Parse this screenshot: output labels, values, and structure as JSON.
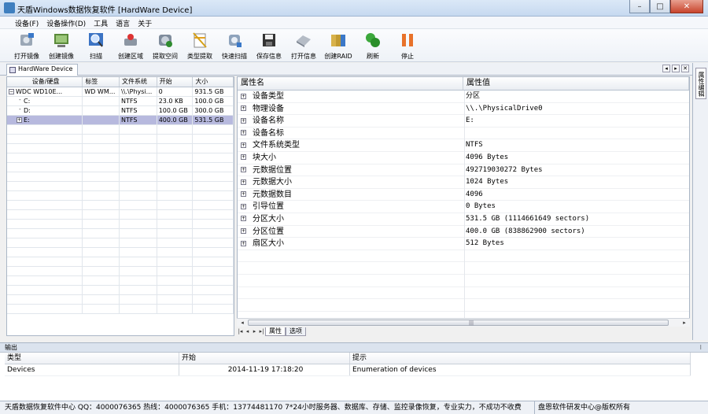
{
  "window": {
    "title": "天盾Windows数据恢复软件  [HardWare Device]",
    "buttons": [
      "–",
      "□",
      "✕"
    ]
  },
  "menu": [
    "设备(F)",
    "设备操作(D)",
    "工具",
    "语言",
    "关于"
  ],
  "toolbar": [
    {
      "label": "打开镜像",
      "icon": "open-image-icon"
    },
    {
      "label": "创建镜像",
      "icon": "create-image-icon"
    },
    {
      "label": "扫描",
      "icon": "scan-icon"
    },
    {
      "label": "创建区域",
      "icon": "create-region-icon"
    },
    {
      "label": "提取空间",
      "icon": "extract-space-icon"
    },
    {
      "label": "类型提取",
      "icon": "type-extract-icon"
    },
    {
      "label": "快速扫描",
      "icon": "quick-scan-icon"
    },
    {
      "label": "保存信息",
      "icon": "save-info-icon"
    },
    {
      "label": "打开信息",
      "icon": "open-info-icon"
    },
    {
      "label": "创建RAID",
      "icon": "create-raid-icon"
    },
    {
      "label": "刷新",
      "icon": "refresh-icon"
    },
    {
      "label": "停止",
      "icon": "stop-icon"
    }
  ],
  "doc_tab": "HardWare Device",
  "side_tab": "属性编辑",
  "device_table": {
    "headers": [
      "设备/硬盘",
      "标签",
      "文件系统",
      "开始",
      "大小"
    ],
    "rows": [
      {
        "expand": "−",
        "indent": 0,
        "name": "WDC WD10E...",
        "label": "WD WM...",
        "fs": "\\\\.\\Physi...",
        "start": "0",
        "size": "931.5 GB",
        "selected": false
      },
      {
        "expand": "",
        "indent": 1,
        "name": "C:",
        "label": "",
        "fs": "NTFS",
        "start": "23.0 KB",
        "size": "100.0 GB",
        "selected": false
      },
      {
        "expand": "",
        "indent": 1,
        "name": "D:",
        "label": "",
        "fs": "NTFS",
        "start": "100.0 GB",
        "size": "300.0 GB",
        "selected": false
      },
      {
        "expand": "+",
        "indent": 1,
        "name": "E:",
        "label": "",
        "fs": "NTFS",
        "start": "400.0 GB",
        "size": "531.5 GB",
        "selected": true
      }
    ],
    "empty_rows": 20
  },
  "properties": {
    "headers": [
      "属性名",
      "属性值"
    ],
    "rows": [
      {
        "name": "设备类型",
        "value": "分区"
      },
      {
        "name": "物理设备",
        "value": "\\\\.\\PhysicalDrive0"
      },
      {
        "name": "设备名称",
        "value": "E:"
      },
      {
        "name": "设备名标",
        "value": ""
      },
      {
        "name": "文件系统类型",
        "value": "NTFS"
      },
      {
        "name": "块大小",
        "value": "4096 Bytes"
      },
      {
        "name": "元数据位置",
        "value": "492719030272 Bytes"
      },
      {
        "name": "元数据大小",
        "value": "1024 Bytes"
      },
      {
        "name": "元数据数目",
        "value": "4096"
      },
      {
        "name": "引导位置",
        "value": "0 Bytes"
      },
      {
        "name": "分区大小",
        "value": "531.5 GB (1114661649 sectors)"
      },
      {
        "name": "分区位置",
        "value": "400.0 GB (838862900 sectors)"
      },
      {
        "name": "扇区大小",
        "value": "512 Bytes"
      }
    ],
    "empty_rows": 6
  },
  "sheet_tabs": {
    "nav": [
      "|◂",
      "◂",
      "▸",
      "▸|"
    ],
    "tabs": [
      "属性",
      "选项"
    ]
  },
  "output": {
    "title": "输出",
    "pin": "⁝",
    "headers": [
      "类型",
      "开始",
      "提示"
    ],
    "rows": [
      {
        "type": "Devices",
        "time": "2014-11-19 17:18:20",
        "msg": "Enumeration of devices"
      }
    ]
  },
  "status": {
    "left": "天盾数据恢复软件中心 QQ：4000076365 热线：4000076365 手机：13774481170  7*24小时服务器、数据库、存储、监控录像恢复，专业实力，不成功不收费",
    "right": "盘恩软件研发中心@版权所有"
  }
}
